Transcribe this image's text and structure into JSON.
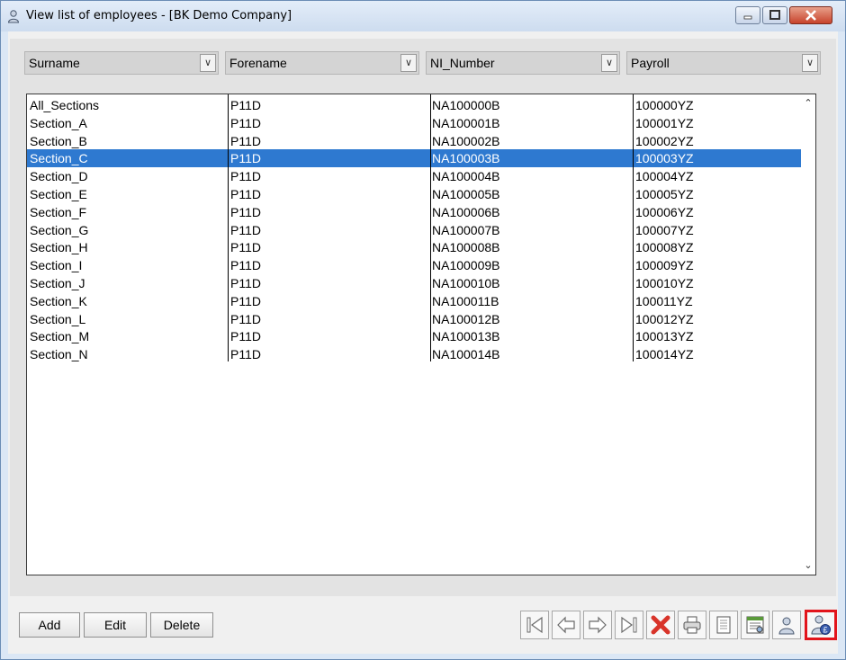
{
  "window": {
    "title": "View list of employees - [BK Demo Company]"
  },
  "columns": [
    {
      "label": "Surname"
    },
    {
      "label": "Forename"
    },
    {
      "label": "NI_Number"
    },
    {
      "label": "Payroll"
    }
  ],
  "rows": [
    {
      "surname": "All_Sections",
      "forename": "P11D",
      "ni": "NA100000B",
      "payroll": "100000YZ"
    },
    {
      "surname": "Section_A",
      "forename": "P11D",
      "ni": "NA100001B",
      "payroll": "100001YZ"
    },
    {
      "surname": "Section_B",
      "forename": "P11D",
      "ni": "NA100002B",
      "payroll": "100002YZ"
    },
    {
      "surname": "Section_C",
      "forename": "P11D",
      "ni": "NA100003B",
      "payroll": "100003YZ",
      "selected": true
    },
    {
      "surname": "Section_D",
      "forename": "P11D",
      "ni": "NA100004B",
      "payroll": "100004YZ"
    },
    {
      "surname": "Section_E",
      "forename": "P11D",
      "ni": "NA100005B",
      "payroll": "100005YZ"
    },
    {
      "surname": "Section_F",
      "forename": "P11D",
      "ni": "NA100006B",
      "payroll": "100006YZ"
    },
    {
      "surname": "Section_G",
      "forename": "P11D",
      "ni": "NA100007B",
      "payroll": "100007YZ"
    },
    {
      "surname": "Section_H",
      "forename": "P11D",
      "ni": "NA100008B",
      "payroll": "100008YZ"
    },
    {
      "surname": "Section_I",
      "forename": "P11D",
      "ni": "NA100009B",
      "payroll": "100009YZ"
    },
    {
      "surname": "Section_J",
      "forename": "P11D",
      "ni": "NA100010B",
      "payroll": "100010YZ"
    },
    {
      "surname": "Section_K",
      "forename": "P11D",
      "ni": "NA100011B",
      "payroll": "100011YZ"
    },
    {
      "surname": "Section_L",
      "forename": "P11D",
      "ni": "NA100012B",
      "payroll": "100012YZ"
    },
    {
      "surname": "Section_M",
      "forename": "P11D",
      "ni": "NA100013B",
      "payroll": "100013YZ"
    },
    {
      "surname": "Section_N",
      "forename": "P11D",
      "ni": "NA100014B",
      "payroll": "100014YZ"
    }
  ],
  "buttons": {
    "add": "Add",
    "edit": "Edit",
    "delete": "Delete"
  },
  "toolbar": [
    {
      "icon": "first-record-icon"
    },
    {
      "icon": "previous-record-icon"
    },
    {
      "icon": "next-record-icon"
    },
    {
      "icon": "last-record-icon"
    },
    {
      "icon": "delete-x-icon"
    },
    {
      "icon": "print-icon"
    },
    {
      "icon": "notepad-icon"
    },
    {
      "icon": "report-icon"
    },
    {
      "icon": "employee-icon"
    },
    {
      "icon": "employee-payroll-icon",
      "highlighted": true
    }
  ],
  "colors": {
    "selection": "#2e79d0",
    "highlight_border": "#e2141b"
  }
}
